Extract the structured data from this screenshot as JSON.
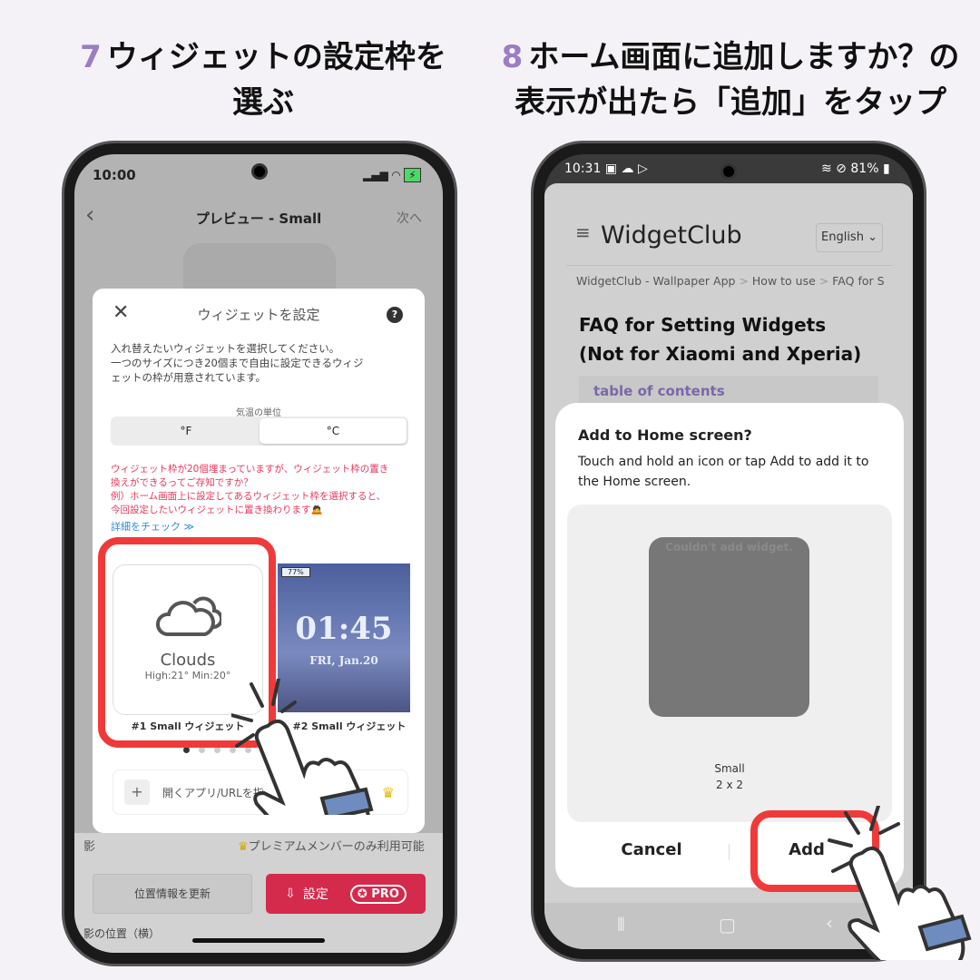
{
  "left_heading": {
    "num": "7",
    "line1": "ウィジェットの設定枠を",
    "line2": "選ぶ"
  },
  "right_heading": {
    "num": "8",
    "line1": "ホーム画面に追加しますか？の",
    "line2": "表示が出たら「追加」をタップ"
  },
  "left_phone": {
    "status": {
      "time": "10:00"
    },
    "nav": {
      "title": "プレビュー - Small",
      "next": "次へ"
    },
    "modal": {
      "title": "ウィジェットを設定",
      "help": "?",
      "description": [
        "入れ替えたいウィジェットを選択してください。",
        "一つのサイズにつき20個まで自由に設定できるウィジ",
        "ェットの枠が用意されています。"
      ],
      "unit_label": "気温の単位",
      "units": [
        "°F",
        "°C"
      ],
      "selected_unit": "°C",
      "notice": [
        "ウィジェット枠が20個埋まっていますが、ウィジェット枠の置き",
        "換えができるってご存知ですか？",
        "例）ホーム画面上に設定してあるウィジェット枠を選択すると、",
        "今回設定したいウィジェットに置き換わります"
      ],
      "details_link": "詳細をチェック ≫",
      "widgets": [
        {
          "label": "#1 Small ウィジェット",
          "condition": "Clouds",
          "temps": "High:21° Min:20°"
        },
        {
          "label": "#2 Small ウィジェット",
          "battery": "77%",
          "time": "01:45",
          "date": "FRI, Jan.20"
        }
      ],
      "page_dots": 6,
      "active_dot": 0,
      "app_url_label": "開くアプリ/URLを指"
    },
    "behind": {
      "shadow_label": "影",
      "premium": "プレミアムメンバーのみ利用可能",
      "update_location": "位置情報を更新",
      "set_button": "設定",
      "pro": "PRO",
      "shadow_pos": "影の位置（横）"
    }
  },
  "right_phone": {
    "status": {
      "time": "10:31",
      "battery": "81%"
    },
    "site": {
      "logo": "WidgetClub",
      "language": "English",
      "breadcrumb": [
        "WidgetClub - Wallpaper App",
        "How to use",
        "FAQ for S"
      ],
      "heading": "FAQ for Setting Widgets (Not for Xiaomi and Xperia)",
      "toc": "table of contents"
    },
    "dialog": {
      "title": "Add to Home screen?",
      "body": "Touch and hold an icon or tap Add to add it to the Home screen.",
      "preview_error": "Couldn't add widget.",
      "size_name": "Small",
      "size": "2 x 2",
      "cancel": "Cancel",
      "add": "Add"
    }
  },
  "colors": {
    "accent_purple": "#9a7dc4",
    "highlight_red": "#f03a3a",
    "notice_red": "#e8375a",
    "link_blue": "#2d8ae0",
    "set_red": "#d42a4c"
  }
}
